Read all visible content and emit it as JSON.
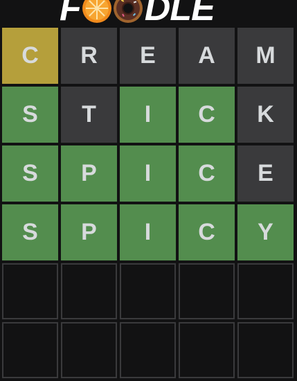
{
  "header": {
    "logo_letters": [
      "F",
      "",
      "",
      "D",
      "L",
      "E"
    ],
    "logo_icons": [
      "orange-slice-icon",
      "donut-icon"
    ]
  },
  "colors": {
    "correct": "#538d4e",
    "present": "#b59f3b",
    "absent": "#3a3a3c",
    "empty_border": "#3a3a3c",
    "background": "#121213"
  },
  "board": {
    "rows": [
      {
        "tiles": [
          {
            "letter": "C",
            "state": "present"
          },
          {
            "letter": "R",
            "state": "absent"
          },
          {
            "letter": "E",
            "state": "absent"
          },
          {
            "letter": "A",
            "state": "absent"
          },
          {
            "letter": "M",
            "state": "absent"
          }
        ]
      },
      {
        "tiles": [
          {
            "letter": "S",
            "state": "correct"
          },
          {
            "letter": "T",
            "state": "absent"
          },
          {
            "letter": "I",
            "state": "correct"
          },
          {
            "letter": "C",
            "state": "correct"
          },
          {
            "letter": "K",
            "state": "absent"
          }
        ]
      },
      {
        "tiles": [
          {
            "letter": "S",
            "state": "correct"
          },
          {
            "letter": "P",
            "state": "correct"
          },
          {
            "letter": "I",
            "state": "correct"
          },
          {
            "letter": "C",
            "state": "correct"
          },
          {
            "letter": "E",
            "state": "absent"
          }
        ]
      },
      {
        "tiles": [
          {
            "letter": "S",
            "state": "correct"
          },
          {
            "letter": "P",
            "state": "correct"
          },
          {
            "letter": "I",
            "state": "correct"
          },
          {
            "letter": "C",
            "state": "correct"
          },
          {
            "letter": "Y",
            "state": "correct"
          }
        ]
      },
      {
        "tiles": [
          {
            "letter": "",
            "state": "empty"
          },
          {
            "letter": "",
            "state": "empty"
          },
          {
            "letter": "",
            "state": "empty"
          },
          {
            "letter": "",
            "state": "empty"
          },
          {
            "letter": "",
            "state": "empty"
          }
        ]
      },
      {
        "tiles": [
          {
            "letter": "",
            "state": "empty"
          },
          {
            "letter": "",
            "state": "empty"
          },
          {
            "letter": "",
            "state": "empty"
          },
          {
            "letter": "",
            "state": "empty"
          },
          {
            "letter": "",
            "state": "empty"
          }
        ]
      }
    ]
  }
}
